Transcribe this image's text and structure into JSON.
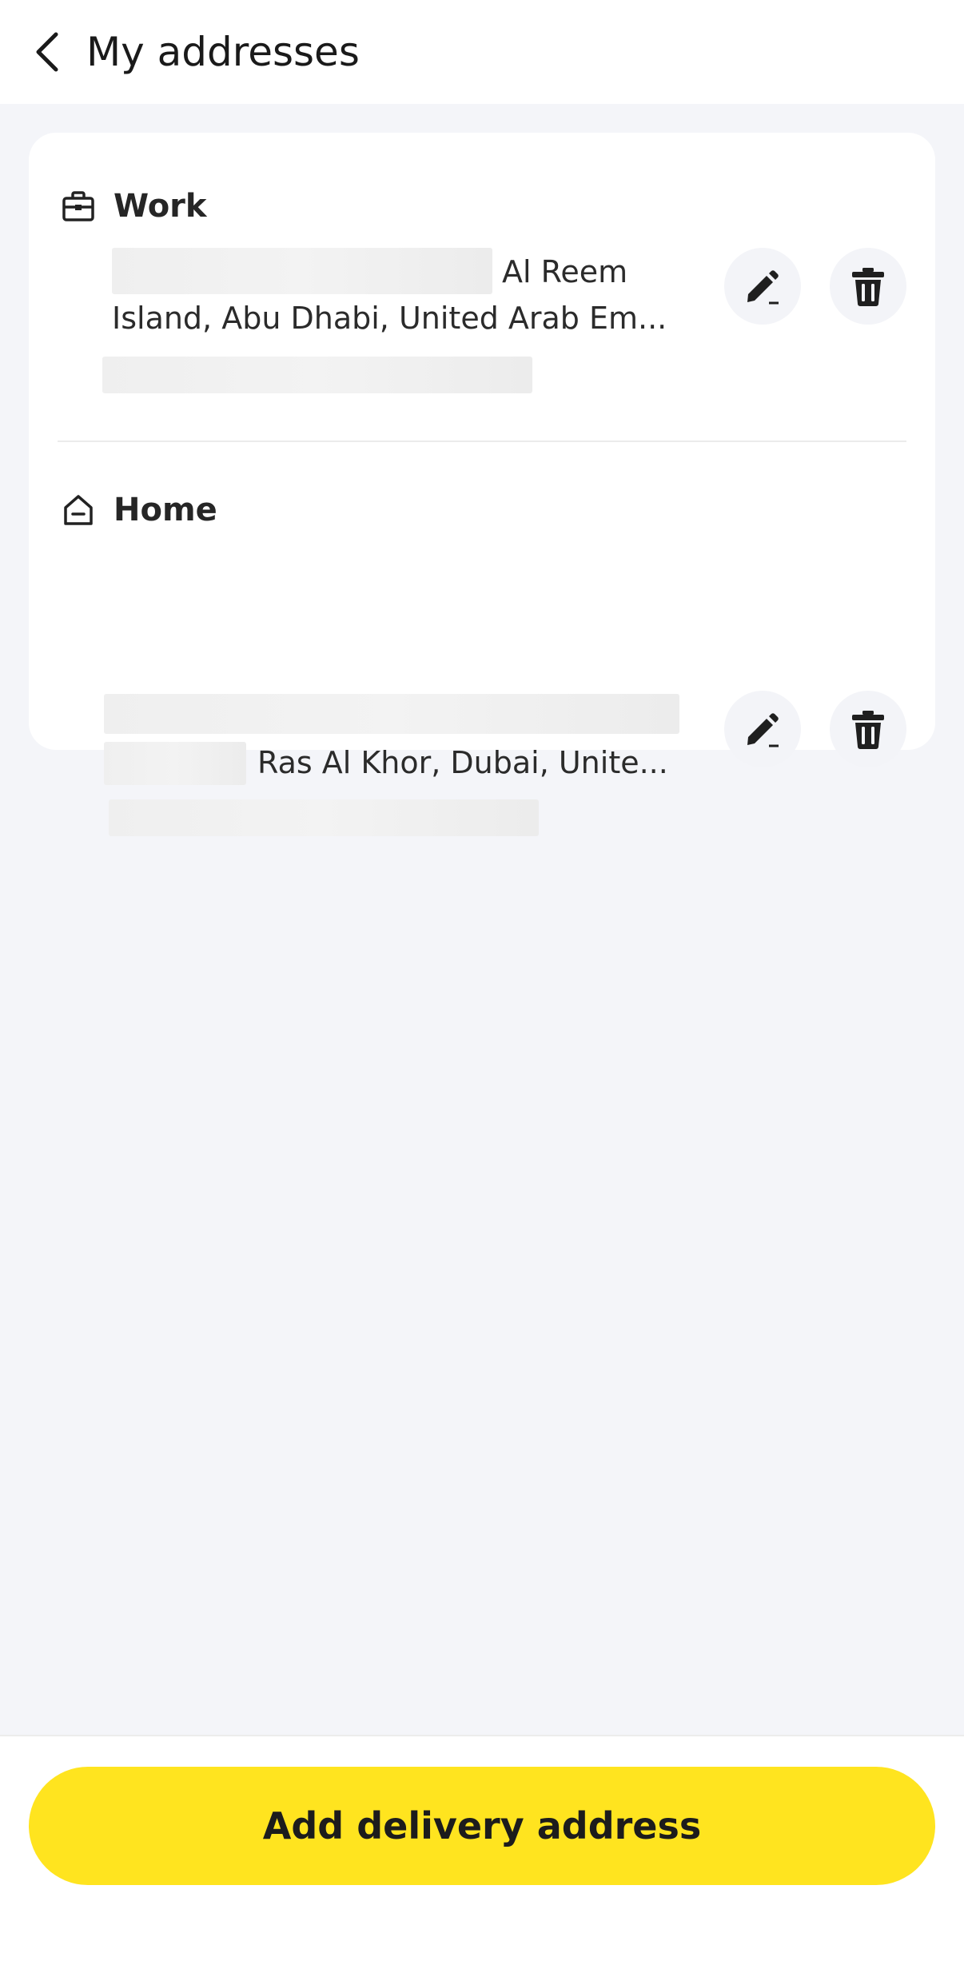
{
  "header": {
    "title": "My addresses",
    "back_icon": "chevron-left-icon"
  },
  "addresses": [
    {
      "label": "Work",
      "icon": "briefcase-icon",
      "line1": "Al Reem",
      "line2": "Island, Abu Dhabi, United Arab Em..."
    },
    {
      "label": "Home",
      "icon": "home-icon",
      "line2": "Ras Al Khor, Dubai, Unite..."
    }
  ],
  "actions": {
    "edit_icon": "pencil-icon",
    "delete_icon": "trash-icon"
  },
  "footer": {
    "add_label": "Add delivery address",
    "accent_color": "#ffe41f"
  }
}
